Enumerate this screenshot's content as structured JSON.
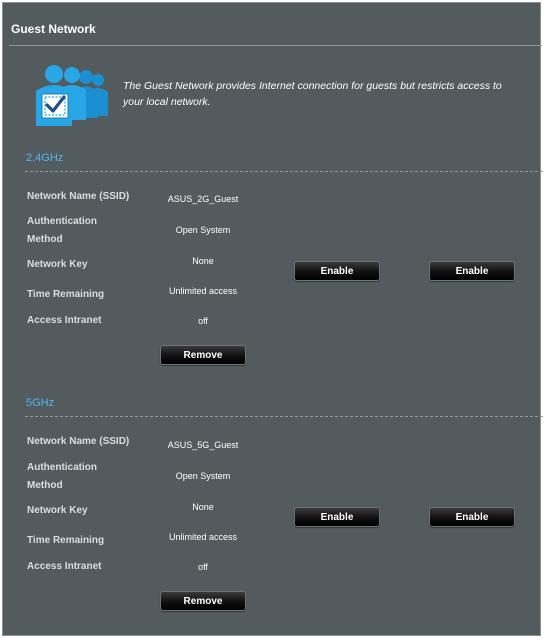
{
  "header": {
    "title": "Guest Network"
  },
  "intro": {
    "icon": "guest-users-check-icon",
    "text": "The Guest Network provides Internet connection for guests but restricts access to your local network."
  },
  "labels": {
    "ssid": "Network Name (SSID)",
    "auth": "Authentication Method",
    "key": "Network Key",
    "time": "Time Remaining",
    "intranet": "Access Intranet"
  },
  "bands": [
    {
      "name": "2.4GHz",
      "ssid": "ASUS_2G_Guest",
      "auth": "Open System",
      "key": "None",
      "time": "Unlimited access",
      "intranet": "off",
      "remove_label": "Remove",
      "enable_labels": [
        "Enable",
        "Enable"
      ]
    },
    {
      "name": "5GHz",
      "ssid": "ASUS_5G_Guest",
      "auth": "Open System",
      "key": "None",
      "time": "Unlimited access",
      "intranet": "off",
      "remove_label": "Remove",
      "enable_labels": [
        "Enable",
        "Enable"
      ]
    }
  ],
  "colors": {
    "panel": "#535b5e",
    "accent": "#4fb7ec",
    "icon_blue": "#29a6e6"
  }
}
